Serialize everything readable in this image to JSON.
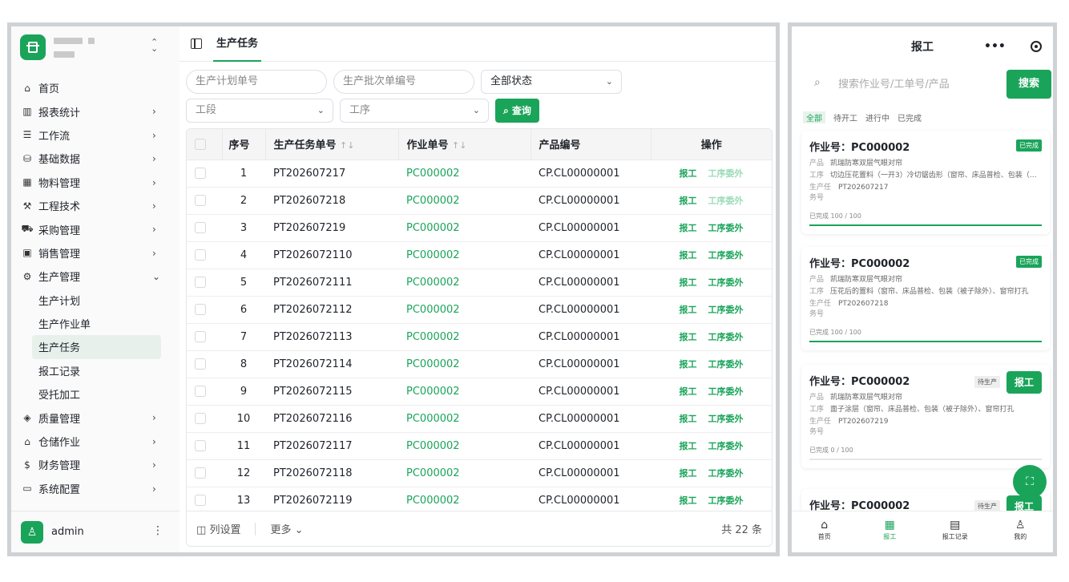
{
  "sidebar": {
    "nav": [
      {
        "label": "首页",
        "icon": "home-icon",
        "glyph": "⌂",
        "arrow": ""
      },
      {
        "label": "报表统计",
        "icon": "chart-icon",
        "glyph": "▥",
        "arrow": "›"
      },
      {
        "label": "工作流",
        "icon": "list-icon",
        "glyph": "☰",
        "arrow": "›"
      },
      {
        "label": "基础数据",
        "icon": "database-icon",
        "glyph": "⛁",
        "arrow": "›"
      },
      {
        "label": "物料管理",
        "icon": "grid-icon",
        "glyph": "▦",
        "arrow": "›"
      },
      {
        "label": "工程技术",
        "icon": "wrench-icon",
        "glyph": "⚒",
        "arrow": "›"
      },
      {
        "label": "采购管理",
        "icon": "cart-icon",
        "glyph": "⛟",
        "arrow": "›"
      },
      {
        "label": "销售管理",
        "icon": "receipt-icon",
        "glyph": "▣",
        "arrow": "›"
      },
      {
        "label": "生产管理",
        "icon": "gear-icon",
        "glyph": "⚙",
        "arrow": "⌄"
      }
    ],
    "sub": [
      "生产计划",
      "生产作业单",
      "生产任务",
      "报工记录",
      "受托加工"
    ],
    "nav2": [
      {
        "label": "质量管理",
        "icon": "shield-icon",
        "glyph": "◈",
        "arrow": "›"
      },
      {
        "label": "仓储作业",
        "icon": "warehouse-icon",
        "glyph": "⌂",
        "arrow": "›"
      },
      {
        "label": "财务管理",
        "icon": "dollar-icon",
        "glyph": "$",
        "arrow": "›"
      },
      {
        "label": "系统配置",
        "icon": "monitor-icon",
        "glyph": "▭",
        "arrow": "›"
      }
    ],
    "user": "admin"
  },
  "main": {
    "tab": "生产任务",
    "filters": {
      "plan_no": "生产计划单号",
      "batch_no": "生产批次单编号",
      "status": "全部状态",
      "section": "工段",
      "process": "工序",
      "query": "查询"
    },
    "table": {
      "headers": [
        "序号",
        "生产任务单号",
        "作业单号",
        "产品编号",
        "操作"
      ],
      "rows": [
        [
          "1",
          "PT202607217",
          "PC000002",
          "CP.CL00000001"
        ],
        [
          "2",
          "PT202607218",
          "PC000002",
          "CP.CL00000001"
        ],
        [
          "3",
          "PT202607219",
          "PC000002",
          "CP.CL00000001"
        ],
        [
          "4",
          "PT2026072110",
          "PC000002",
          "CP.CL00000001"
        ],
        [
          "5",
          "PT2026072111",
          "PC000002",
          "CP.CL00000001"
        ],
        [
          "6",
          "PT2026072112",
          "PC000002",
          "CP.CL00000001"
        ],
        [
          "7",
          "PT2026072113",
          "PC000002",
          "CP.CL00000001"
        ],
        [
          "8",
          "PT2026072114",
          "PC000002",
          "CP.CL00000001"
        ],
        [
          "9",
          "PT2026072115",
          "PC000002",
          "CP.CL00000001"
        ],
        [
          "10",
          "PT2026072116",
          "PC000002",
          "CP.CL00000001"
        ],
        [
          "11",
          "PT2026072117",
          "PC000002",
          "CP.CL00000001"
        ],
        [
          "12",
          "PT2026072118",
          "PC000002",
          "CP.CL00000001"
        ],
        [
          "13",
          "PT2026072119",
          "PC000002",
          "CP.CL00000001"
        ]
      ],
      "action_report": "报工",
      "action_outsource": "工序委外",
      "column_settings": "列设置",
      "more": "更多",
      "total": "共 22 条"
    }
  },
  "mobile": {
    "title": "报工",
    "search_placeholder": "搜索作业号/工单号/产品",
    "search_btn": "搜索",
    "tabs": [
      "全部",
      "待开工",
      "进行中",
      "已完成"
    ],
    "cards": [
      {
        "title": "作业号：PC000002",
        "badge": "已完成",
        "done": true,
        "product": "凯瑞防寒双层气眼对帘",
        "process": "切边压花置料（一开3）冷切锯齿形（窗帘、床品普检、包装（被子除外）、窗帘打孔",
        "task": "PT202607217",
        "progress": "已完成 100 / 100",
        "pct": 1
      },
      {
        "title": "作业号：PC000002",
        "badge": "已完成",
        "done": true,
        "product": "凯瑞防寒双层气眼对帘",
        "process": "压花后的置料（窗帘、床品普检、包装（被子除外）、窗帘打孔",
        "task": "PT202607218",
        "progress": "已完成 100 / 100",
        "pct": 1
      },
      {
        "title": "作业号：PC000002",
        "badge": "待生产",
        "done": false,
        "product": "凯瑞防寒双层气眼对帘",
        "process": "面子涂层（窗帘、床品普检、包装（被子除外）、窗帘打孔",
        "task": "PT202607219",
        "progress": "已完成 0 / 100",
        "pct": 0
      },
      {
        "title": "作业号：PC000002",
        "badge": "待生产",
        "done": false
      }
    ],
    "labels": {
      "product": "产品",
      "process": "工序",
      "task": "生产任务号",
      "report": "报工"
    },
    "nav": [
      "首页",
      "报工",
      "报工记录",
      "我的"
    ]
  }
}
